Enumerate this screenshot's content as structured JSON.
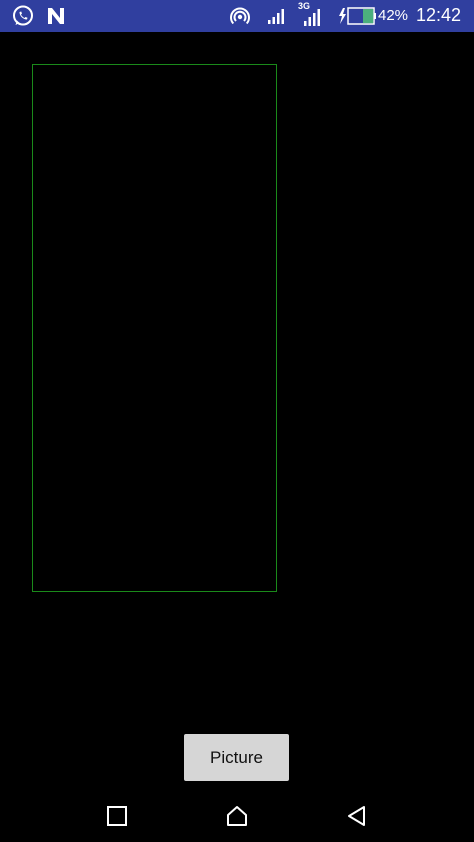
{
  "status_bar": {
    "battery_percent": "42%",
    "clock": "12:42",
    "network_label": "3G",
    "background_color": "#303f9f",
    "icons": [
      "whatsapp-icon",
      "n-notification-icon",
      "hotspot-icon",
      "signal-icon",
      "3g-signal-icon",
      "battery-charging-icon"
    ]
  },
  "preview": {
    "border_color": "#1a8a1a"
  },
  "actions": {
    "picture_label": "Picture"
  },
  "nav_bar": {
    "icons": [
      "recents-square-icon",
      "home-icon",
      "back-triangle-icon"
    ]
  }
}
